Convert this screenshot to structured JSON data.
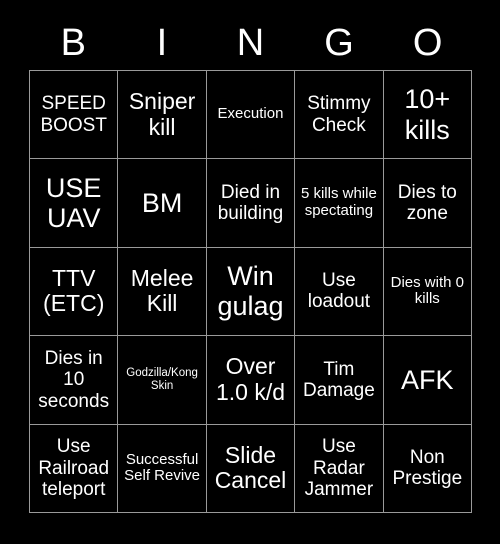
{
  "card": {
    "header_letters": [
      "B",
      "I",
      "N",
      "G",
      "O"
    ],
    "rows": [
      [
        {
          "text": "SPEED BOOST",
          "size": "fs-md"
        },
        {
          "text": "Sniper kill",
          "size": "fs-lg"
        },
        {
          "text": "Execution",
          "size": "fs-sm"
        },
        {
          "text": "Stimmy Check",
          "size": "fs-md"
        },
        {
          "text": "10+ kills",
          "size": "fs-xl"
        }
      ],
      [
        {
          "text": "USE UAV",
          "size": "fs-xl"
        },
        {
          "text": "BM",
          "size": "fs-xl"
        },
        {
          "text": "Died in building",
          "size": "fs-md"
        },
        {
          "text": "5 kills while spectating",
          "size": "fs-sm"
        },
        {
          "text": "Dies to zone",
          "size": "fs-md"
        }
      ],
      [
        {
          "text": "TTV (ETC)",
          "size": "fs-lg"
        },
        {
          "text": "Melee Kill",
          "size": "fs-lg"
        },
        {
          "text": "Win gulag",
          "size": "fs-xl"
        },
        {
          "text": "Use loadout",
          "size": "fs-md"
        },
        {
          "text": "Dies with 0 kills",
          "size": "fs-sm"
        }
      ],
      [
        {
          "text": "Dies in 10 seconds",
          "size": "fs-md"
        },
        {
          "text": "Godzilla/Kong Skin",
          "size": "fs-xs"
        },
        {
          "text": "Over 1.0 k/d",
          "size": "fs-lg"
        },
        {
          "text": "Tim Damage",
          "size": "fs-md"
        },
        {
          "text": "AFK",
          "size": "fs-xl"
        }
      ],
      [
        {
          "text": "Use Railroad teleport",
          "size": "fs-md"
        },
        {
          "text": "Successful Self Revive",
          "size": "fs-sm"
        },
        {
          "text": "Slide Cancel",
          "size": "fs-lg"
        },
        {
          "text": "Use Radar Jammer",
          "size": "fs-md"
        },
        {
          "text": "Non Prestige",
          "size": "fs-md"
        }
      ]
    ]
  },
  "colors": {
    "background": "#000000",
    "text": "#ffffff",
    "grid_line": "#9a9a9a"
  }
}
